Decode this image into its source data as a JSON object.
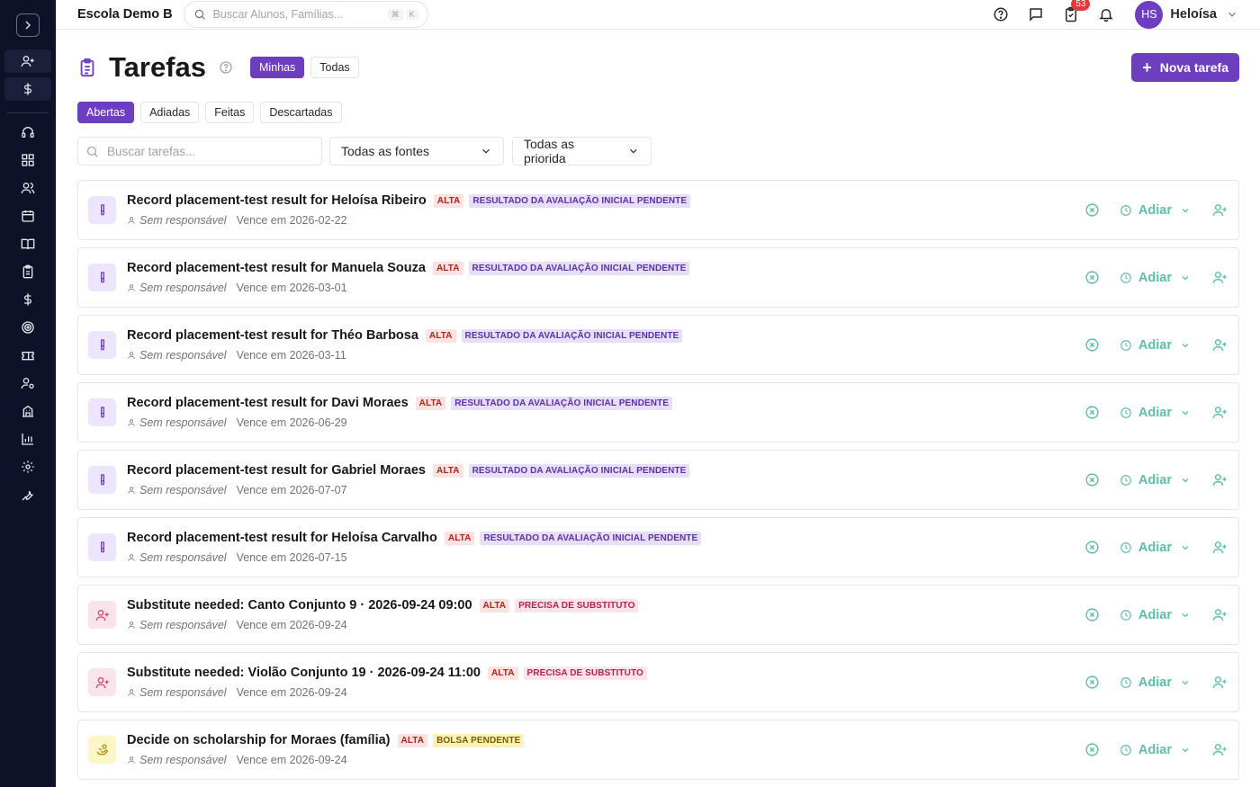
{
  "header": {
    "school_name": "Escola Demo B",
    "search_placeholder": "Buscar Alunos, Famílias...",
    "shortcut_keys": [
      "⌘",
      "K"
    ],
    "notification_count": "53",
    "user_initials": "HS",
    "user_name": "Heloísa"
  },
  "sidebar": {
    "icons": [
      "chevron-right-icon",
      "user-plus-icon",
      "dollar-icon",
      "headset-icon",
      "dashboard-icon",
      "users-icon",
      "calendar-icon",
      "book-icon",
      "clipboard-icon",
      "dollar-icon",
      "target-icon",
      "ticket-icon",
      "user-cog-icon",
      "building-icon",
      "bar-chart-icon",
      "settings-icon",
      "wrench-icon"
    ]
  },
  "page": {
    "title": "Tarefas",
    "scope_tabs": [
      "Minhas",
      "Todas"
    ],
    "active_scope": "Minhas",
    "new_task_label": "Nova tarefa",
    "status_tabs": [
      "Abertas",
      "Adiadas",
      "Feitas",
      "Descartadas"
    ],
    "active_status": "Abertas",
    "task_search_placeholder": "Buscar tarefas...",
    "source_filter": "Todas as fontes",
    "priority_filter": "Todas as priorida",
    "snooze_label": "Adiar"
  },
  "tasks": [
    {
      "title": "Record placement-test result for Heloísa Ribeiro",
      "priority": "ALTA",
      "tag": "RESULTADO DA AVALIAÇÃO INICIAL PENDENTE",
      "kind": "placement",
      "assignee": "Sem responsável",
      "due": "Vence em 2026-02-22"
    },
    {
      "title": "Record placement-test result for Manuela Souza",
      "priority": "ALTA",
      "tag": "RESULTADO DA AVALIAÇÃO INICIAL PENDENTE",
      "kind": "placement",
      "assignee": "Sem responsável",
      "due": "Vence em 2026-03-01"
    },
    {
      "title": "Record placement-test result for Théo Barbosa",
      "priority": "ALTA",
      "tag": "RESULTADO DA AVALIAÇÃO INICIAL PENDENTE",
      "kind": "placement",
      "assignee": "Sem responsável",
      "due": "Vence em 2026-03-11"
    },
    {
      "title": "Record placement-test result for Davi Moraes",
      "priority": "ALTA",
      "tag": "RESULTADO DA AVALIAÇÃO INICIAL PENDENTE",
      "kind": "placement",
      "assignee": "Sem responsável",
      "due": "Vence em 2026-06-29"
    },
    {
      "title": "Record placement-test result for Gabriel Moraes",
      "priority": "ALTA",
      "tag": "RESULTADO DA AVALIAÇÃO INICIAL PENDENTE",
      "kind": "placement",
      "assignee": "Sem responsável",
      "due": "Vence em 2026-07-07"
    },
    {
      "title": "Record placement-test result for Heloísa Carvalho",
      "priority": "ALTA",
      "tag": "RESULTADO DA AVALIAÇÃO INICIAL PENDENTE",
      "kind": "placement",
      "assignee": "Sem responsável",
      "due": "Vence em 2026-07-15"
    },
    {
      "title": "Substitute needed: Canto Conjunto 9 · 2026-09-24 09:00",
      "priority": "ALTA",
      "tag": "PRECISA DE SUBSTITUTO",
      "kind": "substitute",
      "assignee": "Sem responsável",
      "due": "Vence em 2026-09-24"
    },
    {
      "title": "Substitute needed: Violão Conjunto 19 · 2026-09-24 11:00",
      "priority": "ALTA",
      "tag": "PRECISA DE SUBSTITUTO",
      "kind": "substitute",
      "assignee": "Sem responsável",
      "due": "Vence em 2026-09-24"
    },
    {
      "title": "Decide on scholarship for Moraes (família)",
      "priority": "ALTA",
      "tag": "BOLSA PENDENTE",
      "kind": "scholarship",
      "assignee": "Sem responsável",
      "due": "Vence em 2026-09-24"
    }
  ],
  "colors": {
    "sidebar_bg": "#0f1129",
    "brand_purple": "#6d3fc0",
    "action_teal": "#5cbfa8",
    "badge_red": "#e53935"
  }
}
